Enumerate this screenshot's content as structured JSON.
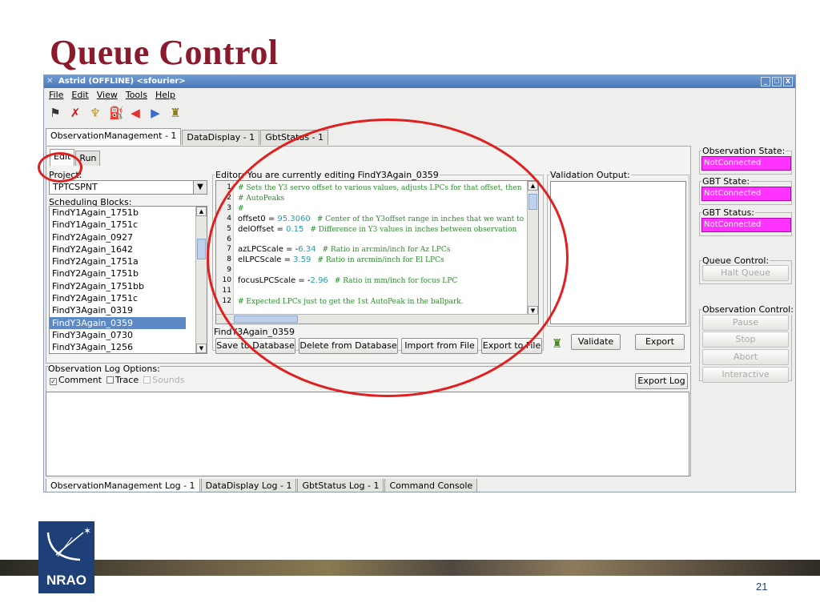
{
  "slide": {
    "title": "Queue Control",
    "page_number": "21",
    "logo_text": "NRAO"
  },
  "window": {
    "title": "Astrid (OFFLINE) <sfourier>",
    "controls": [
      "_",
      "☐",
      "X"
    ]
  },
  "menu": [
    "File",
    "Edit",
    "View",
    "Tools",
    "Help"
  ],
  "toolbar_icons": [
    "flag-icon",
    "delete-x-icon",
    "dish-icon",
    "pipe-icon",
    "back-arrow-icon",
    "forward-arrow-icon",
    "bottle-icon"
  ],
  "main_tabs": [
    "ObservationManagement - 1",
    "DataDisplay - 1",
    "GbtStatus - 1"
  ],
  "sub_tabs": [
    "Edit",
    "Run"
  ],
  "project": {
    "label": "Project:",
    "value": "TPTCSPNT"
  },
  "scheduling": {
    "label": "Scheduling Blocks:",
    "items": [
      "FindY1Again_1751b",
      "FindY1Again_1751c",
      "FindY2Again_0927",
      "FindY2Again_1642",
      "FindY2Again_1751a",
      "FindY2Again_1751b",
      "FindY2Again_1751bb",
      "FindY2Again_1751c",
      "FindY3Again_0319",
      "FindY3Again_0359",
      "FindY3Again_0730",
      "FindY3Again_1256"
    ],
    "selected_index": 9
  },
  "editor": {
    "label": "Editor: You are currently editing FindY3Again_0359",
    "filename": "FindY3Again_0359",
    "lines": [
      {
        "n": "1",
        "code": "",
        "value": "",
        "comment": "# Sets the Y3 servo offset to various values, adjusts LPCs for that offset, then"
      },
      {
        "n": "2",
        "code": "",
        "value": "",
        "comment": "# AutoPeaks"
      },
      {
        "n": "3",
        "code": "",
        "value": "",
        "comment": "#"
      },
      {
        "n": "4",
        "code": "offset0 = ",
        "value": "95.3060",
        "comment": "# Center of the Y3offset range in inches that we want to"
      },
      {
        "n": "5",
        "code": "delOffset = ",
        "value": "0.15",
        "comment": "# Difference in Y3 values in inches between observation"
      },
      {
        "n": "6",
        "code": "",
        "value": "",
        "comment": ""
      },
      {
        "n": "7",
        "code": "azLPCScale = -",
        "value": "6.34",
        "comment": "# Ratio in arcmin/inch for Az LPCs"
      },
      {
        "n": "8",
        "code": "elLPCScale = ",
        "value": "3.59",
        "comment": "# Ratio in arcmin/inch for El LPCs"
      },
      {
        "n": "9",
        "code": "",
        "value": "",
        "comment": ""
      },
      {
        "n": "10",
        "code": "focusLPCScale = -",
        "value": "2.96",
        "comment": "# Ratio in mm/inch for focus LPC"
      },
      {
        "n": "11",
        "code": "",
        "value": "",
        "comment": ""
      },
      {
        "n": "12",
        "code": "",
        "value": "",
        "comment": "# Expected LPCs just to get the 1st AutoPeak in the ballpark."
      }
    ]
  },
  "editor_buttons": [
    "Save to Database",
    "Delete from Database",
    "Import from File",
    "Export to File"
  ],
  "validation": {
    "label": "Validation Output:",
    "validate_label": "Validate",
    "export_label": "Export"
  },
  "log": {
    "label": "Observation Log Options:",
    "options": [
      {
        "label": "Comment",
        "checked": true,
        "enabled": true
      },
      {
        "label": "Trace",
        "checked": false,
        "enabled": true
      },
      {
        "label": "Sounds",
        "checked": false,
        "enabled": false
      }
    ],
    "export_label": "Export Log"
  },
  "bottom_tabs": [
    "ObservationManagement Log - 1",
    "DataDisplay Log - 1",
    "GbtStatus Log - 1",
    "Command Console"
  ],
  "status": {
    "observation_state": {
      "label": "Observation State:",
      "value": "NotConnected"
    },
    "gbt_state": {
      "label": "GBT State:",
      "value": "NotConnected"
    },
    "gbt_status": {
      "label": "GBT Status:",
      "value": "NotConnected"
    },
    "queue_control": {
      "label": "Queue Control:",
      "button": "Halt Queue"
    },
    "observation_control": {
      "label": "Observation Control:",
      "buttons": [
        "Pause",
        "Stop",
        "Abort",
        "Interactive"
      ]
    },
    "alert_color": "#ff33ff"
  }
}
